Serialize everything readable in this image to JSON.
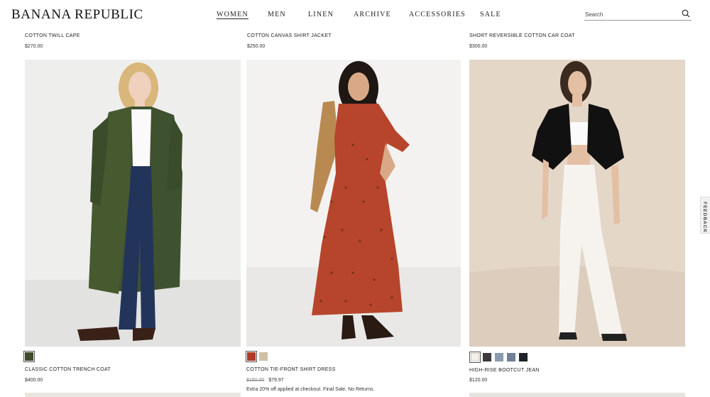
{
  "header": {
    "logo": "BANANA REPUBLIC",
    "nav": [
      {
        "label": "WOMEN",
        "active": true
      },
      {
        "label": "MEN",
        "active": false
      },
      {
        "label": "LINEN",
        "active": false
      },
      {
        "label": "ARCHIVE",
        "active": false
      },
      {
        "label": "ACCESSORIES",
        "active": false
      },
      {
        "label": "SALE",
        "active": false
      }
    ],
    "search": {
      "placeholder": "Search",
      "icon": "search-icon"
    }
  },
  "top_row": [
    {
      "name": "COTTON TWILL CAPE",
      "price": "$270.00"
    },
    {
      "name": "COTTON CANVAS SHIRT JACKET",
      "price": "$250.00"
    },
    {
      "name": "SHORT REVERSIBLE COTTON CAR COAT",
      "price": "$300.00"
    }
  ],
  "products": [
    {
      "name": "CLASSIC COTTON TRENCH COAT",
      "price": "$400.00",
      "swatches": [
        "#3e4a2c"
      ],
      "selected": 0
    },
    {
      "name": "COTTON TIE-FRONT SHIRT DRESS",
      "original_price": "$150.00",
      "price": "$79.97",
      "promo": "Extra 20% off applied at checkout. Final Sale. No Returns.",
      "swatches": [
        "#b03a26",
        "#cfc1a8"
      ],
      "selected": 0
    },
    {
      "name": "HIGH-RISE BOOTCUT JEAN",
      "price": "$120.00",
      "swatches": [
        "#f4f1ea",
        "#3a3a3c",
        "#8a9aae",
        "#6f8096",
        "#1f2226"
      ],
      "selected": 0
    }
  ],
  "feedback": {
    "label": "FEEDBACK"
  },
  "colors": {
    "accent": "#222222"
  }
}
